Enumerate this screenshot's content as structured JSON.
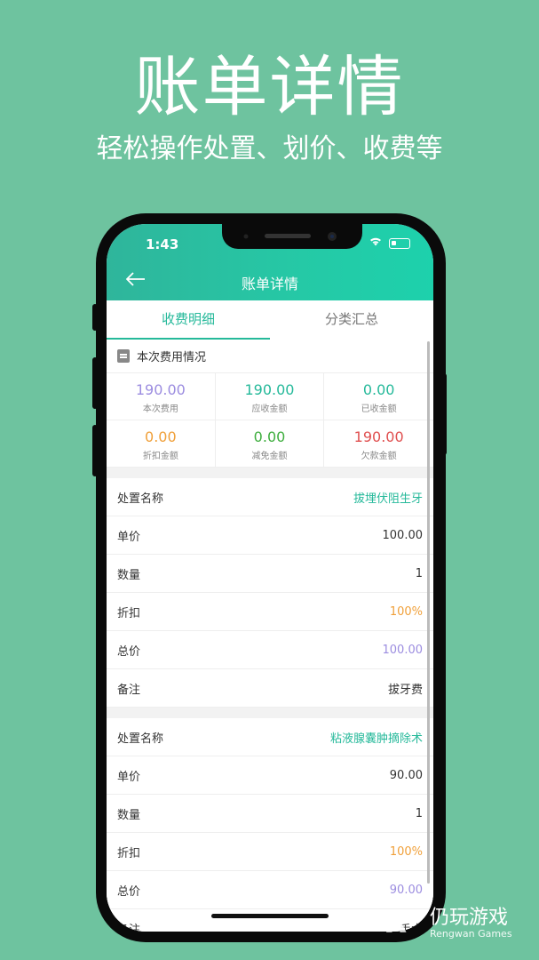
{
  "promo": {
    "title": "账单详情",
    "subtitle": "轻松操作处置、划价、收费等"
  },
  "status_bar": {
    "time": "1:43",
    "wifi_icon": "wifi-icon",
    "battery_icon": "battery-icon"
  },
  "nav": {
    "back_icon": "arrow-left-icon",
    "title": "账单详情"
  },
  "tabs": [
    {
      "label": "收费明细",
      "active": true
    },
    {
      "label": "分类汇总",
      "active": false
    }
  ],
  "summary": {
    "header": "本次费用情况",
    "cells": [
      {
        "value": "190.00",
        "label": "本次费用",
        "color": "#9c8de0"
      },
      {
        "value": "190.00",
        "label": "应收金额",
        "color": "#25b99a"
      },
      {
        "value": "0.00",
        "label": "已收金额",
        "color": "#25b99a"
      },
      {
        "value": "0.00",
        "label": "折扣金额",
        "color": "#f0a03a"
      },
      {
        "value": "0.00",
        "label": "减免金额",
        "color": "#3fae3f"
      },
      {
        "value": "190.00",
        "label": "欠款金额",
        "color": "#e05050"
      }
    ]
  },
  "items": [
    {
      "rows": [
        {
          "label": "处置名称",
          "value": "拔埋伏阻生牙",
          "color": "#25b99a"
        },
        {
          "label": "单价",
          "value": "100.00",
          "color": "#333333"
        },
        {
          "label": "数量",
          "value": "1",
          "color": "#333333"
        },
        {
          "label": "折扣",
          "value": "100%",
          "color": "#f0a03a"
        },
        {
          "label": "总价",
          "value": "100.00",
          "color": "#9c8de0"
        },
        {
          "label": "备注",
          "value": "拔牙费",
          "color": "#333333"
        }
      ]
    },
    {
      "rows": [
        {
          "label": "处置名称",
          "value": "粘液腺囊肿摘除术",
          "color": "#25b99a"
        },
        {
          "label": "单价",
          "value": "90.00",
          "color": "#333333"
        },
        {
          "label": "数量",
          "value": "1",
          "color": "#333333"
        },
        {
          "label": "折扣",
          "value": "100%",
          "color": "#f0a03a"
        },
        {
          "label": "总价",
          "value": "90.00",
          "color": "#9c8de0"
        },
        {
          "label": "备注",
          "value": "手术",
          "color": "#333333"
        }
      ]
    }
  ],
  "watermark": {
    "cn": "仍玩游戏",
    "en": "Rengwan Games",
    "logo": "R"
  }
}
